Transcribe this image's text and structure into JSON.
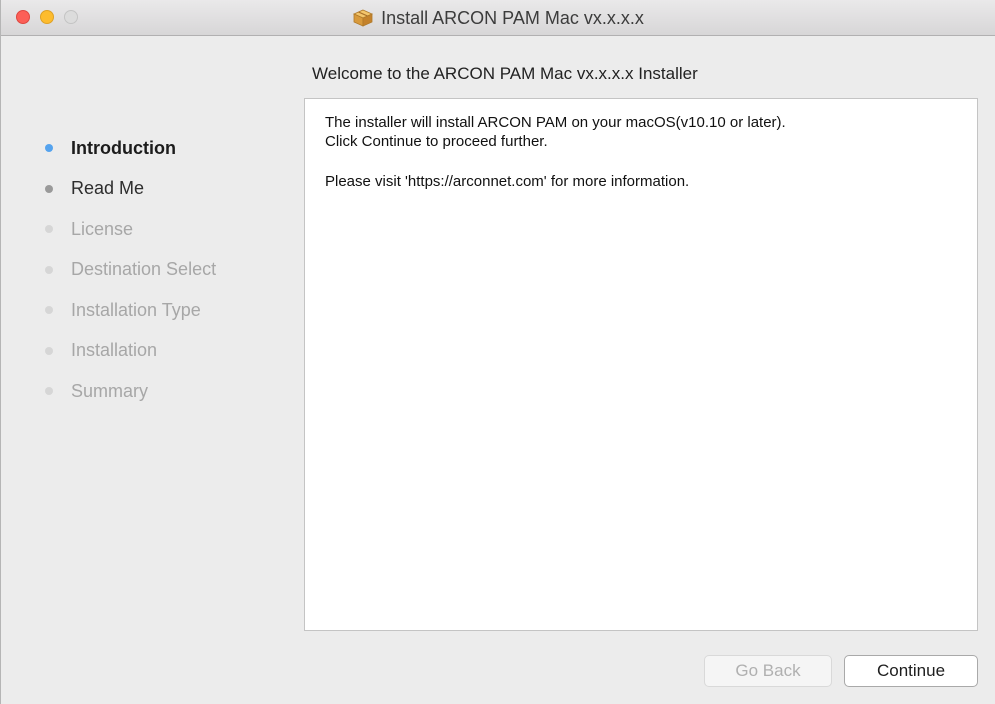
{
  "window": {
    "title": "Install ARCON PAM Mac vx.x.x.x",
    "title_icon": "package-icon"
  },
  "main": {
    "heading": "Welcome to the ARCON PAM Mac vx.x.x.x Installer",
    "body_line1": "The installer will install ARCON PAM on your macOS(v10.10 or later).",
    "body_line2": "Click Continue to proceed further.",
    "body_line3": "Please visit 'https://arconnet.com' for more information."
  },
  "sidebar": {
    "steps": [
      {
        "label": "Introduction",
        "state": "active"
      },
      {
        "label": "Read Me",
        "state": "done"
      },
      {
        "label": "License",
        "state": "todo"
      },
      {
        "label": "Destination Select",
        "state": "todo"
      },
      {
        "label": "Installation Type",
        "state": "todo"
      },
      {
        "label": "Installation",
        "state": "todo"
      },
      {
        "label": "Summary",
        "state": "todo"
      }
    ]
  },
  "buttons": {
    "go_back": "Go Back",
    "continue": "Continue"
  },
  "colors": {
    "active_dot": "#55a3ee",
    "close": "#fc5f57",
    "minimize": "#fdbc2e"
  }
}
